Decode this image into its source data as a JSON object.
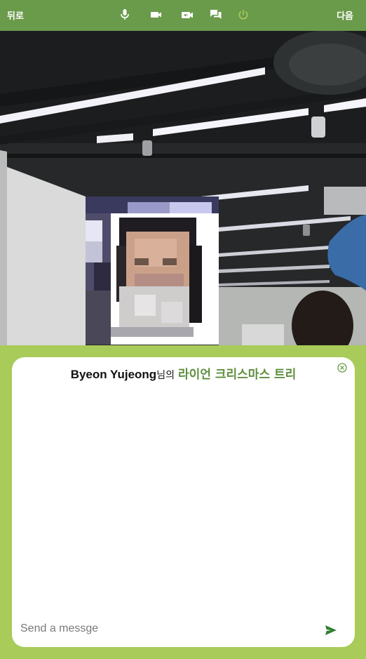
{
  "topbar": {
    "back_label": "뒤로",
    "next_label": "다음",
    "tools": [
      "microphone-icon",
      "camera-icon",
      "camera-switch-icon",
      "chat-icon",
      "power-icon"
    ],
    "accent": "#6a9b4b",
    "power_color": "#a8cb59"
  },
  "chat": {
    "user_name": "Byeon Yujeong",
    "suffix": "님의",
    "room_name": "라이언 크리스마스 트리",
    "placeholder": "Send a messge",
    "accent": "#5e8e3e",
    "send_color": "#2e7d32"
  },
  "page_background": "#a8cb59"
}
